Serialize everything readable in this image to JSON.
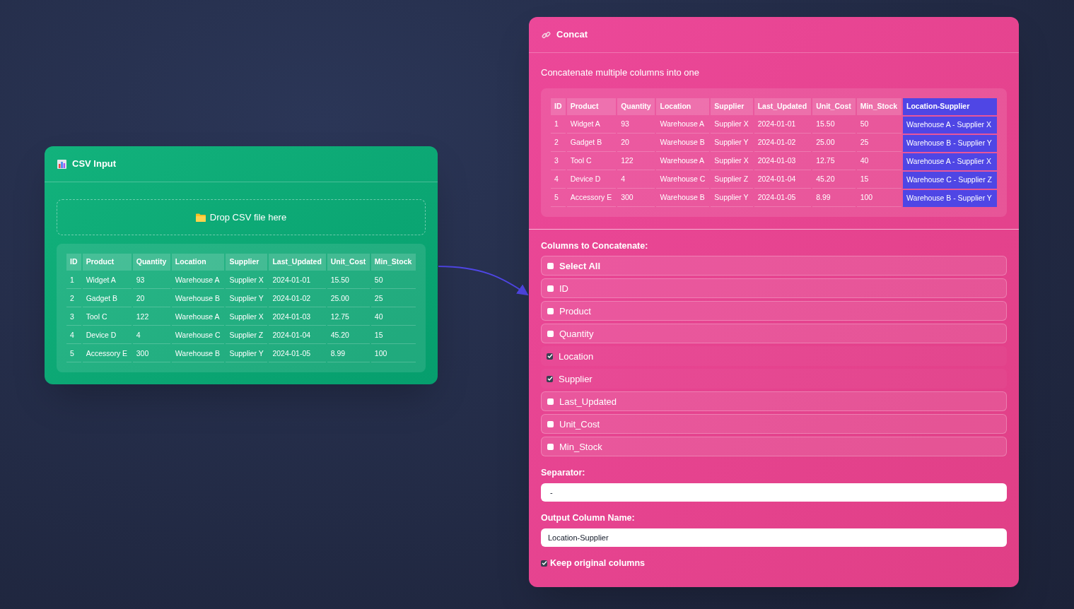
{
  "csv_node": {
    "title": "CSV Input",
    "dropzone": "Drop CSV file here",
    "table": {
      "columns": [
        "ID",
        "Product",
        "Quantity",
        "Location",
        "Supplier",
        "Last_Updated",
        "Unit_Cost",
        "Min_Stock"
      ],
      "rows": [
        [
          "1",
          "Widget A",
          "93",
          "Warehouse A",
          "Supplier X",
          "2024-01-01",
          "15.50",
          "50"
        ],
        [
          "2",
          "Gadget B",
          "20",
          "Warehouse B",
          "Supplier Y",
          "2024-01-02",
          "25.00",
          "25"
        ],
        [
          "3",
          "Tool C",
          "122",
          "Warehouse A",
          "Supplier X",
          "2024-01-03",
          "12.75",
          "40"
        ],
        [
          "4",
          "Device D",
          "4",
          "Warehouse C",
          "Supplier Z",
          "2024-01-04",
          "45.20",
          "15"
        ],
        [
          "5",
          "Accessory E",
          "300",
          "Warehouse B",
          "Supplier Y",
          "2024-01-05",
          "8.99",
          "100"
        ]
      ]
    }
  },
  "concat_node": {
    "title": "Concat",
    "description": "Concatenate multiple columns into one",
    "table": {
      "columns": [
        {
          "label": "ID",
          "kind": "source"
        },
        {
          "label": "Product",
          "kind": "source"
        },
        {
          "label": "Quantity",
          "kind": "source"
        },
        {
          "label": "Location",
          "kind": "source"
        },
        {
          "label": "Supplier",
          "kind": "source"
        },
        {
          "label": "Last_Updated",
          "kind": "source"
        },
        {
          "label": "Unit_Cost",
          "kind": "source"
        },
        {
          "label": "Min_Stock",
          "kind": "source"
        },
        {
          "label": "Location-Supplier",
          "kind": "output"
        }
      ],
      "rows": [
        [
          "1",
          "Widget A",
          "93",
          "Warehouse A",
          "Supplier X",
          "2024-01-01",
          "15.50",
          "50",
          "Warehouse A - Supplier X"
        ],
        [
          "2",
          "Gadget B",
          "20",
          "Warehouse B",
          "Supplier Y",
          "2024-01-02",
          "25.00",
          "25",
          "Warehouse B - Supplier Y"
        ],
        [
          "3",
          "Tool C",
          "122",
          "Warehouse A",
          "Supplier X",
          "2024-01-03",
          "12.75",
          "40",
          "Warehouse A - Supplier X"
        ],
        [
          "4",
          "Device D",
          "4",
          "Warehouse C",
          "Supplier Z",
          "2024-01-04",
          "45.20",
          "15",
          "Warehouse C - Supplier Z"
        ],
        [
          "5",
          "Accessory E",
          "300",
          "Warehouse B",
          "Supplier Y",
          "2024-01-05",
          "8.99",
          "100",
          "Warehouse B - Supplier Y"
        ]
      ]
    },
    "columns_label": "Columns to Concatenate:",
    "options": [
      {
        "label": "Select All",
        "kind": "all",
        "checked": false
      },
      {
        "label": "ID",
        "kind": "column",
        "checked": false
      },
      {
        "label": "Product",
        "kind": "column",
        "checked": false
      },
      {
        "label": "Quantity",
        "kind": "column",
        "checked": false
      },
      {
        "label": "Location",
        "kind": "column",
        "checked": true
      },
      {
        "label": "Supplier",
        "kind": "column",
        "checked": true
      },
      {
        "label": "Last_Updated",
        "kind": "column",
        "checked": false
      },
      {
        "label": "Unit_Cost",
        "kind": "column",
        "checked": false
      },
      {
        "label": "Min_Stock",
        "kind": "column",
        "checked": false
      }
    ],
    "separator_label": "Separator:",
    "separator_value": " - ",
    "output_label": "Output Column Name:",
    "output_value": "Location-Supplier",
    "keep_original": {
      "label": "Keep original columns",
      "checked": true
    }
  }
}
